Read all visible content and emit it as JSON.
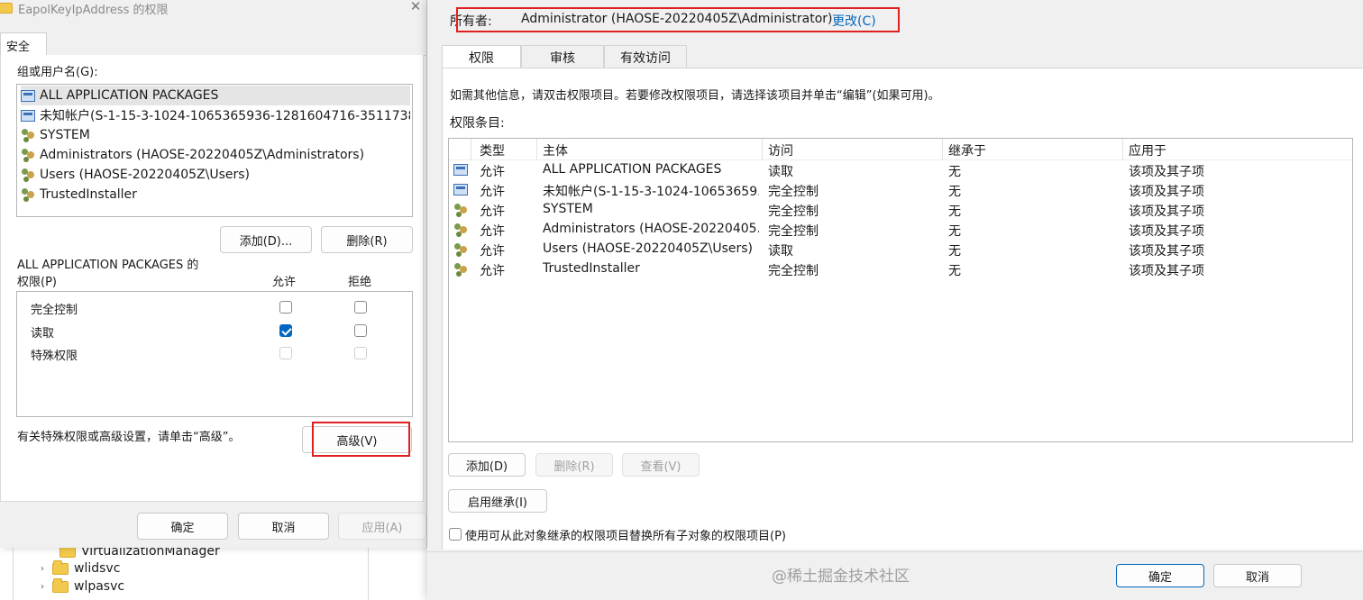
{
  "tree": {
    "items": [
      {
        "label": "VirtualizationManager"
      },
      {
        "label": "wlidsvc"
      },
      {
        "label": "wlpasvc"
      }
    ]
  },
  "left_dialog": {
    "title": "EapolKeyIpAddress 的权限",
    "tab_security": "安全",
    "group_label": "组或用户名(G):",
    "principals": [
      {
        "label": "ALL APPLICATION PACKAGES",
        "icon": "package-icon"
      },
      {
        "label": "未知帐户(S-1-15-3-1024-1065365936-1281604716-3511738...",
        "icon": "package-icon"
      },
      {
        "label": "SYSTEM",
        "icon": "users-icon"
      },
      {
        "label": "Administrators (HAOSE-20220405Z\\Administrators)",
        "icon": "users-icon"
      },
      {
        "label": "Users (HAOSE-20220405Z\\Users)",
        "icon": "users-icon"
      },
      {
        "label": "TrustedInstaller",
        "icon": "users-icon"
      }
    ],
    "add_button": "添加(D)...",
    "remove_button": "删除(R)",
    "perm_for_line1": "ALL APPLICATION PACKAGES 的",
    "perm_for_line2": "权限(P)",
    "col_allow": "允许",
    "col_deny": "拒绝",
    "permissions": [
      {
        "label": "完全控制",
        "allow": false,
        "deny": false,
        "disabled": false
      },
      {
        "label": "读取",
        "allow": true,
        "deny": false,
        "disabled": false
      },
      {
        "label": "特殊权限",
        "allow": false,
        "deny": false,
        "disabled": true
      }
    ],
    "advanced_hint": "有关特殊权限或高级设置，请单击“高级”。",
    "advanced_button": "高级(V)",
    "ok_button": "确定",
    "cancel_button": "取消",
    "apply_button": "应用(A)"
  },
  "right_dialog": {
    "owner_label": "所有者:",
    "owner_value": "Administrator (HAOSE-20220405Z\\Administrator)",
    "change_link": "更改(C)",
    "tabs": [
      "权限",
      "审核",
      "有效访问"
    ],
    "info_text": "如需其他信息，请双击权限项目。若要修改权限项目，请选择该项目并单击“编辑”(如果可用)。",
    "entries_label": "权限条目:",
    "columns": [
      "类型",
      "主体",
      "访问",
      "继承于",
      "应用于"
    ],
    "rows": [
      {
        "icon": "package-icon",
        "type": "允许",
        "principal": "ALL APPLICATION PACKAGES",
        "access": "读取",
        "inherited": "无",
        "applies": "该项及其子项"
      },
      {
        "icon": "package-icon",
        "type": "允许",
        "principal": "未知帐户(S-1-15-3-1024-10653659...",
        "access": "完全控制",
        "inherited": "无",
        "applies": "该项及其子项"
      },
      {
        "icon": "users-icon",
        "type": "允许",
        "principal": "SYSTEM",
        "access": "完全控制",
        "inherited": "无",
        "applies": "该项及其子项"
      },
      {
        "icon": "users-icon",
        "type": "允许",
        "principal": "Administrators (HAOSE-20220405...",
        "access": "完全控制",
        "inherited": "无",
        "applies": "该项及其子项"
      },
      {
        "icon": "users-icon",
        "type": "允许",
        "principal": "Users (HAOSE-20220405Z\\Users)",
        "access": "读取",
        "inherited": "无",
        "applies": "该项及其子项"
      },
      {
        "icon": "users-icon",
        "type": "允许",
        "principal": "TrustedInstaller",
        "access": "完全控制",
        "inherited": "无",
        "applies": "该项及其子项"
      }
    ],
    "add_button": "添加(D)",
    "remove_button": "删除(R)",
    "view_button": "查看(V)",
    "enable_inheritance_button": "启用继承(I)",
    "replace_checkbox_label": "使用可从此对象继承的权限项目替换所有子对象的权限项目(P)",
    "ok_button": "确定",
    "cancel_button": "取消"
  },
  "watermark": "@稀土掘金技术社区"
}
